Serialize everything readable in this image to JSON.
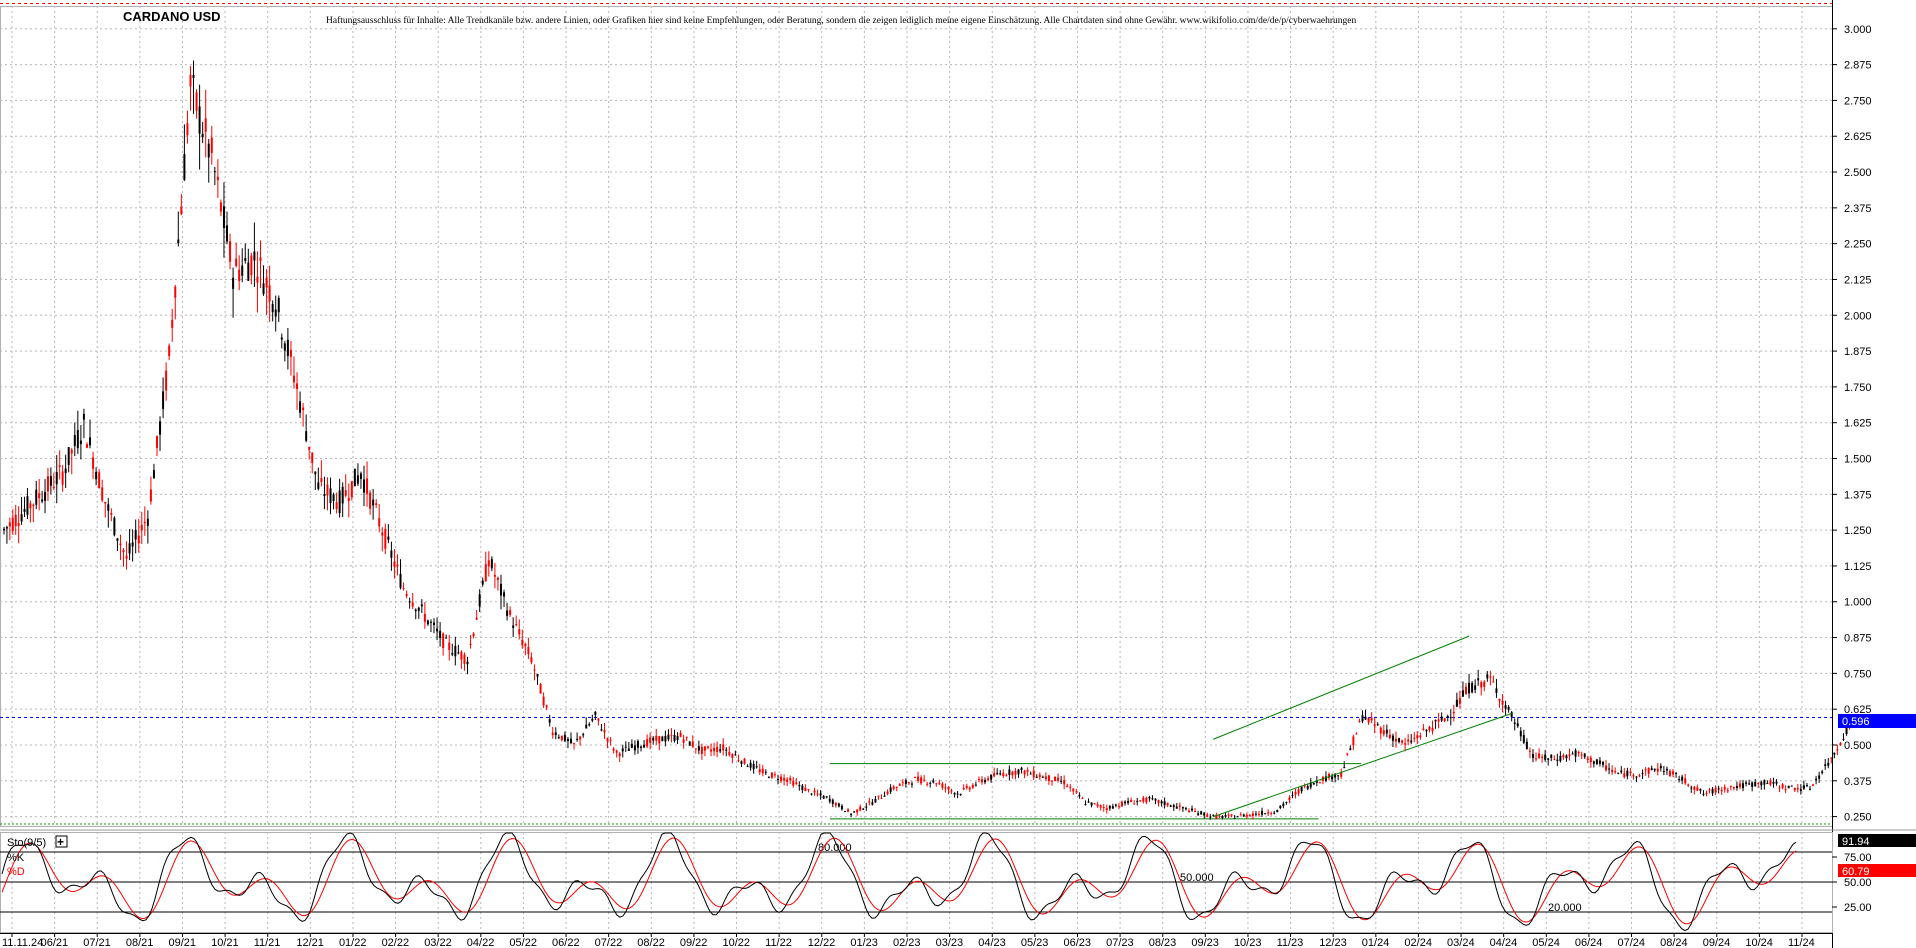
{
  "chart_data": [
    {
      "type": "candlestick",
      "title": "CARDANO USD",
      "subtitle": "Haftungsausschluss für Inhalte: Alle Trendkanäle bzw. andere Linien, oder Grafiken hier sind keine Empfehlungen, oder Beratung, sondern die zeigen lediglich meine eigene Einschätzung. Alle Chartdaten sind ohne Gewähr. www.wikifolio.com/de/de/p/cyberwaehrungen",
      "y_ticks": [
        "3.000",
        "2.875",
        "2.750",
        "2.625",
        "2.500",
        "2.375",
        "2.250",
        "2.125",
        "2.000",
        "1.875",
        "1.750",
        "1.625",
        "1.500",
        "1.375",
        "1.250",
        "1.125",
        "1.000",
        "0.875",
        "0.750",
        "0.625",
        "0.500",
        "0.375",
        "0.250"
      ],
      "ylim": [
        0.23,
        3.16
      ],
      "x_ticks": [
        "11.11.24",
        "06/21",
        "07/21",
        "08/21",
        "09/21",
        "10/21",
        "11/21",
        "12/21",
        "01/22",
        "02/22",
        "03/22",
        "04/22",
        "05/22",
        "06/22",
        "07/22",
        "08/22",
        "09/22",
        "10/22",
        "11/22",
        "12/22",
        "01/23",
        "02/23",
        "03/23",
        "04/23",
        "05/23",
        "06/23",
        "07/23",
        "08/23",
        "09/23",
        "10/23",
        "11/23",
        "12/23",
        "01/24",
        "02/24",
        "03/24",
        "04/24",
        "05/24",
        "06/24",
        "07/24",
        "08/24",
        "09/24",
        "10/24",
        "11/24"
      ],
      "series": [
        {
          "points": [
            [
              "05/21",
              1.25
            ],
            [
              "06/21",
              1.45
            ],
            [
              "06/21",
              1.62
            ],
            [
              "07/21",
              1.35
            ],
            [
              "07/21",
              1.15
            ],
            [
              "08/21",
              1.3
            ],
            [
              "08/21",
              1.85
            ],
            [
              "09/21",
              2.8
            ],
            [
              "09/21",
              2.55
            ],
            [
              "10/21",
              2.15
            ],
            [
              "10/21",
              2.2
            ],
            [
              "11/21",
              2.05
            ],
            [
              "11/21",
              1.75
            ],
            [
              "12/21",
              1.4
            ],
            [
              "12/21",
              1.35
            ],
            [
              "01/22",
              1.45
            ],
            [
              "01/22",
              1.25
            ],
            [
              "02/22",
              1.05
            ],
            [
              "03/22",
              0.85
            ],
            [
              "03/22",
              0.8
            ],
            [
              "04/22",
              1.15
            ],
            [
              "04/22",
              0.95
            ],
            [
              "05/22",
              0.8
            ],
            [
              "05/22",
              0.55
            ],
            [
              "06/22",
              0.5
            ],
            [
              "06/22",
              0.6
            ],
            [
              "07/22",
              0.47
            ],
            [
              "07/22",
              0.5
            ],
            [
              "08/22",
              0.52
            ],
            [
              "08/22",
              0.53
            ],
            [
              "09/22",
              0.48
            ],
            [
              "09/22",
              0.49
            ],
            [
              "10/22",
              0.44
            ],
            [
              "10/22",
              0.4
            ],
            [
              "11/22",
              0.38
            ],
            [
              "11/22",
              0.34
            ],
            [
              "12/22",
              0.31
            ],
            [
              "12/22",
              0.26
            ],
            [
              "01/23",
              0.3
            ],
            [
              "01/23",
              0.35
            ],
            [
              "02/23",
              0.38
            ],
            [
              "02/23",
              0.37
            ],
            [
              "03/23",
              0.33
            ],
            [
              "03/23",
              0.37
            ],
            [
              "04/23",
              0.4
            ],
            [
              "04/23",
              0.41
            ],
            [
              "05/23",
              0.39
            ],
            [
              "05/23",
              0.37
            ],
            [
              "06/23",
              0.3
            ],
            [
              "06/23",
              0.28
            ],
            [
              "07/23",
              0.3
            ],
            [
              "07/23",
              0.31
            ],
            [
              "08/23",
              0.29
            ],
            [
              "08/23",
              0.27
            ],
            [
              "09/23",
              0.25
            ],
            [
              "09/23",
              0.25
            ],
            [
              "10/23",
              0.26
            ],
            [
              "10/23",
              0.27
            ],
            [
              "11/23",
              0.34
            ],
            [
              "11/23",
              0.38
            ],
            [
              "12/23",
              0.4
            ],
            [
              "12/23",
              0.6
            ],
            [
              "01/24",
              0.55
            ],
            [
              "01/24",
              0.5
            ],
            [
              "02/24",
              0.55
            ],
            [
              "02/24",
              0.6
            ],
            [
              "03/24",
              0.7
            ],
            [
              "03/24",
              0.73
            ],
            [
              "04/24",
              0.6
            ],
            [
              "04/24",
              0.46
            ],
            [
              "05/24",
              0.45
            ],
            [
              "05/24",
              0.47
            ],
            [
              "06/24",
              0.44
            ],
            [
              "06/24",
              0.4
            ],
            [
              "07/24",
              0.4
            ],
            [
              "07/24",
              0.42
            ],
            [
              "08/24",
              0.38
            ],
            [
              "08/24",
              0.33
            ],
            [
              "09/24",
              0.35
            ],
            [
              "09/24",
              0.36
            ],
            [
              "10/24",
              0.37
            ],
            [
              "10/24",
              0.35
            ],
            [
              "11/24",
              0.35
            ],
            [
              "11/24",
              0.45
            ],
            [
              "11/24",
              0.596
            ]
          ]
        }
      ],
      "current_price": "0.596",
      "trend_lines": {
        "channel_upper": [
          [
            "09/23",
            0.52
          ],
          [
            "03/24",
            0.88
          ]
        ],
        "channel_lower": [
          [
            "09/23",
            0.25
          ],
          [
            "04/24",
            0.61
          ]
        ],
        "range_top": [
          [
            "12/22",
            0.435
          ],
          [
            "12/23",
            0.435
          ]
        ],
        "range_bottom": [
          [
            "12/22",
            0.242
          ],
          [
            "11/23",
            0.242
          ]
        ]
      },
      "colors": {
        "up": "#000000",
        "down": "#ff0000",
        "trend": "#008000",
        "price_tag": "#0000ff"
      }
    },
    {
      "type": "line",
      "title": "Sto(9/5)",
      "series": [
        {
          "name": "%K",
          "color": "#000000",
          "value": "91.94"
        },
        {
          "name": "%D",
          "color": "#ff0000",
          "value": "60.79"
        }
      ],
      "y_ticks": [
        "75.00",
        "50.00",
        "25.00"
      ],
      "ylim": [
        0,
        100
      ],
      "levels": [
        {
          "value": 80,
          "label": "80.000"
        },
        {
          "value": 50,
          "label": "50.000"
        },
        {
          "value": 20,
          "label": "20.000"
        }
      ]
    }
  ]
}
